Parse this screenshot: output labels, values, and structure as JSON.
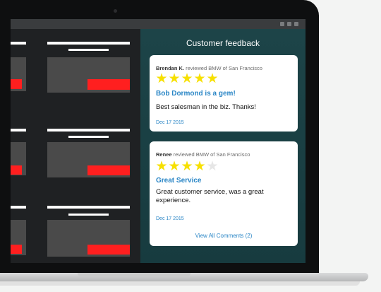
{
  "feedback": {
    "title": "Customer feedback",
    "reviews": [
      {
        "reviewer": "Brendan K.",
        "action": "reviewed BMW of San Francisco",
        "stars": 5,
        "headline": "Bob Dormond is a gem!",
        "body": "Best salesman in the biz. Thanks!",
        "date": "Dec 17 2015"
      },
      {
        "reviewer": "Renee",
        "action": "reviewed BMW of San Francisco",
        "stars": 4,
        "headline": "Great Service",
        "body": "Great customer service, was a great experience.",
        "date": "Dec 17 2015"
      }
    ],
    "view_all_label": "View All Comments (2)"
  },
  "colors": {
    "panel": "#1d4448",
    "accent": "#2a86c6",
    "star": "#f7e000",
    "tile_red": "#ff1f1f"
  },
  "icons": [
    "star-icon"
  ]
}
